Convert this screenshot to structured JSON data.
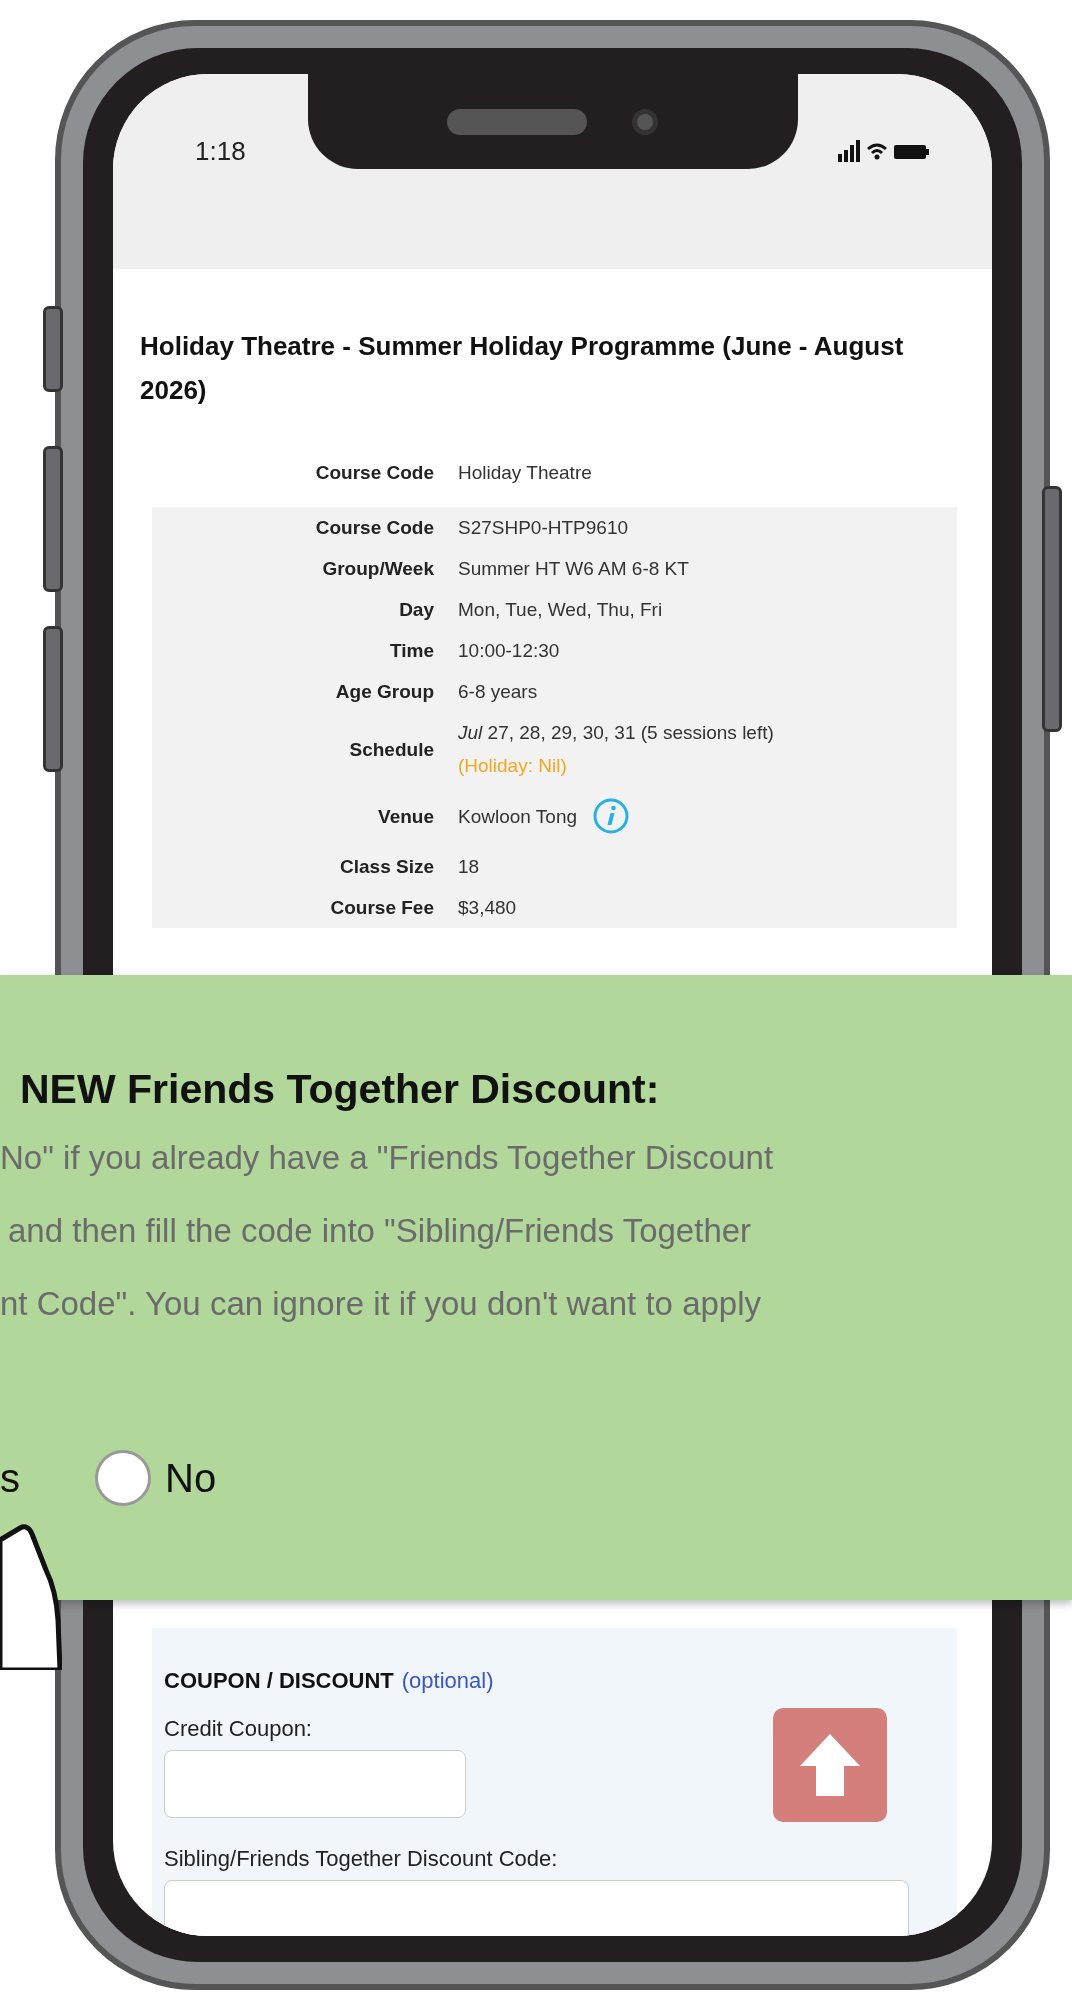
{
  "status_bar": {
    "time": "1:18"
  },
  "page": {
    "title": "Holiday Theatre - Summer Holiday Programme (June - August 2026)",
    "details": [
      {
        "label": "Course Code",
        "value": "Holiday Theatre",
        "shaded": false
      },
      {
        "label": "Course Code",
        "value": "S27SHP0-HTP9610",
        "shaded": true
      },
      {
        "label": "Group/Week",
        "value": "Summer HT W6 AM 6-8 KT",
        "shaded": true
      },
      {
        "label": "Day",
        "value": "Mon, Tue, Wed, Thu, Fri",
        "shaded": true
      },
      {
        "label": "Time",
        "value": "10:00-12:30",
        "shaded": true
      },
      {
        "label": "Age Group",
        "value": "6-8 years",
        "shaded": true
      },
      {
        "label": "Schedule",
        "value": "*Jul* 27, 28, 29, 30, 31 (5 sessions left)",
        "note": "(Holiday: Nil)",
        "shaded": true
      },
      {
        "label": "Venue",
        "value": "Kowloon Tong",
        "info": true,
        "shaded": true
      },
      {
        "label": "Class Size",
        "value": "18",
        "shaded": true
      },
      {
        "label": "Course Fee",
        "value": "$3,480",
        "shaded": true
      }
    ],
    "coupon": {
      "heading": "COUPON / DISCOUNT",
      "optional": "(optional)",
      "credit_label": "Credit Coupon:",
      "sibling_label": "Sibling/Friends Together Discount Code:"
    }
  },
  "banner": {
    "heading": "NEW Friends Together Discount:",
    "lines": [
      "No\" if you already have a \"Friends Together Discount",
      "and then fill the code into \"Sibling/Friends Together",
      "nt Code\". You can ignore it if you don't want to apply"
    ],
    "yes_fragment": "s",
    "no_option": {
      "label": "No",
      "selected": false
    }
  }
}
